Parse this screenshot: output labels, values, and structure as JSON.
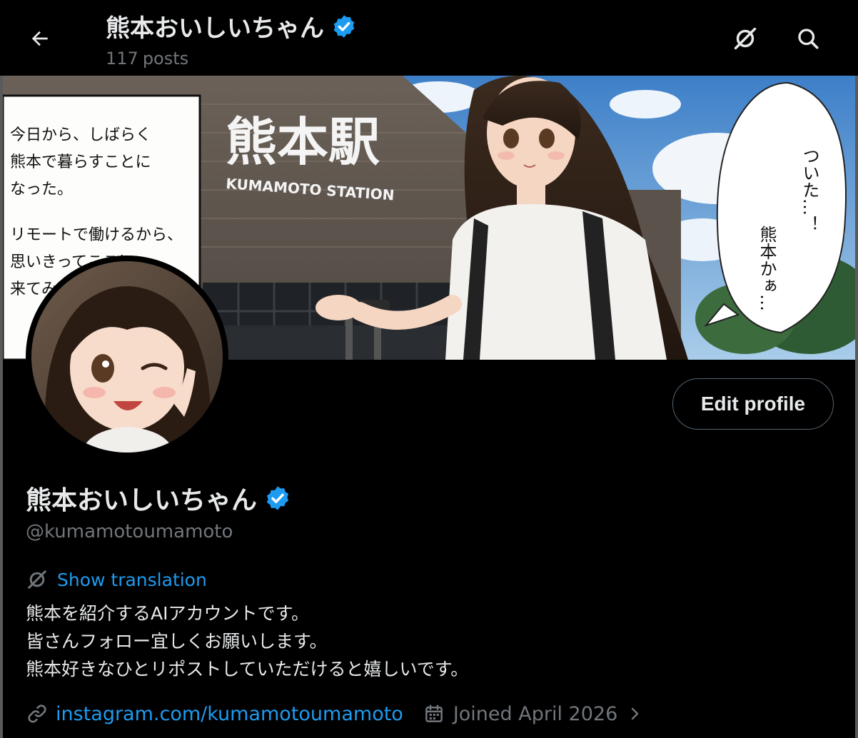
{
  "header": {
    "display_name": "熊本おいしいちゃん",
    "posts_count": "117",
    "posts_label": "posts",
    "back_icon": "arrow-left-icon",
    "translate_icon": "translate-icon",
    "search_icon": "search-icon"
  },
  "banner": {
    "caption_lines": [
      "今日から、しばらく",
      "熊本で暮らすことに",
      "なった。",
      "リモートで働けるから、",
      "思いきってここに",
      "来てみた。"
    ],
    "station_name": "熊本駅",
    "station_romaji": "KUMAMOTO STATION",
    "speech_col1": "ついた…！",
    "speech_col2": "熊本かぁ…"
  },
  "profile": {
    "display_name": "熊本おいしいちゃん",
    "handle": "@kumamotoumamoto",
    "edit_button": "Edit profile",
    "show_translation": "Show translation",
    "bio_lines": [
      "熊本を紹介するAIアカウントです。",
      "皆さんフォロー宜しくお願いします。",
      "熊本好きなひとリポストしていただけると嬉しいです。"
    ],
    "link_text": "instagram.com/kumamotoumamoto",
    "joined": "Joined April 2026"
  },
  "colors": {
    "background": "#000000",
    "text_primary": "#e7e9ea",
    "text_secondary": "#71767b",
    "accent": "#1d9bf0",
    "verified": "#1d9bf0",
    "border": "#536471"
  }
}
